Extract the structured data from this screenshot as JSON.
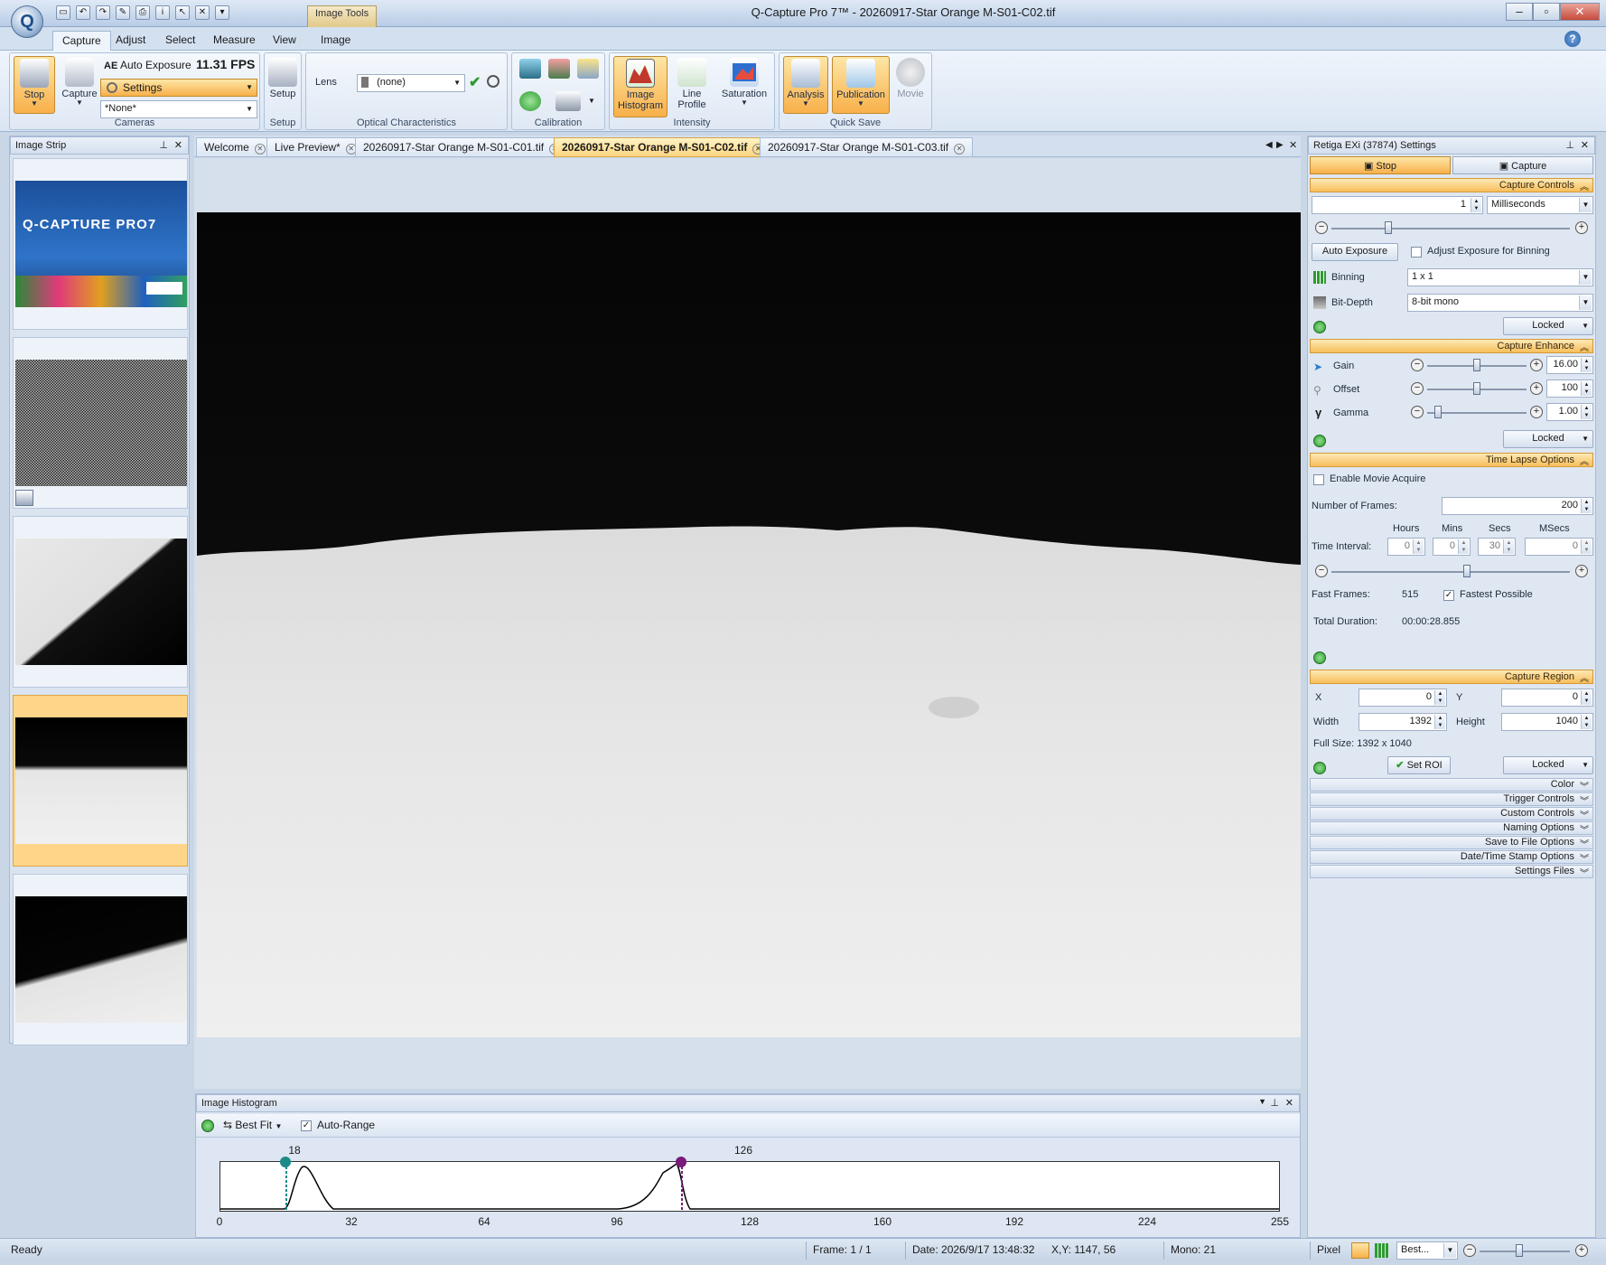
{
  "window": {
    "title": "Q-Capture Pro 7™ - 20260917-Star Orange M-S01-C02.tif",
    "app_logo": "Q",
    "contextual_tab": "Image Tools"
  },
  "ribbon_tabs": [
    "Capture",
    "Adjust",
    "Select",
    "Measure",
    "View",
    "Image"
  ],
  "ribbon": {
    "cameras": {
      "label": "Cameras",
      "stop": "Stop",
      "capture": "Capture",
      "auto_exposure": "Auto Exposure",
      "fps": "11.31 FPS",
      "settings": "Settings",
      "preset": "*None*"
    },
    "setup": {
      "label": "Setup",
      "button": "Setup"
    },
    "optical": {
      "label": "Optical Characteristics",
      "lens_label": "Lens",
      "lens_value": "(none)"
    },
    "calibration": {
      "label": "Calibration"
    },
    "intensity": {
      "label": "Intensity",
      "image_histogram_1": "Image",
      "image_histogram_2": "Histogram",
      "line_profile_1": "Line",
      "line_profile_2": "Profile",
      "saturation": "Saturation"
    },
    "quick_save": {
      "label": "Quick Save",
      "analysis": "Analysis",
      "publication": "Publication",
      "movie": "Movie"
    }
  },
  "image_strip": {
    "title": "Image Strip",
    "splash_brand": "Q-CAPTURE PRO7"
  },
  "doc_tabs": [
    "Welcome",
    "Live Preview*",
    "20260917-Star Orange M-S01-C01.tif",
    "20260917-Star Orange M-S01-C02.tif",
    "20260917-Star Orange M-S01-C03.tif"
  ],
  "histogram": {
    "title": "Image Histogram",
    "best_fit": "Best Fit",
    "auto_range": "Auto-Range",
    "low_marker": "18",
    "high_marker": "126",
    "ticks": [
      "0",
      "32",
      "64",
      "96",
      "128",
      "160",
      "192",
      "224",
      "255"
    ]
  },
  "settings": {
    "title": "Retiga EXi (37874) Settings",
    "stop": "Stop",
    "capture": "Capture",
    "capture_controls": {
      "header": "Capture Controls",
      "exposure_value": "1",
      "exposure_unit": "Milliseconds",
      "auto_exposure": "Auto Exposure",
      "adjust_binning": "Adjust Exposure for Binning",
      "binning_label": "Binning",
      "binning_value": "1 x 1",
      "bitdepth_label": "Bit-Depth",
      "bitdepth_value": "8-bit mono",
      "locked": "Locked"
    },
    "capture_enhance": {
      "header": "Capture Enhance",
      "gain_label": "Gain",
      "gain_value": "16.00",
      "offset_label": "Offset",
      "offset_value": "100",
      "gamma_label": "Gamma",
      "gamma_value": "1.00",
      "locked": "Locked"
    },
    "time_lapse": {
      "header": "Time Lapse Options",
      "enable_movie": "Enable Movie Acquire",
      "frames_label": "Number of  Frames:",
      "frames_value": "200",
      "col_hours": "Hours",
      "col_mins": "Mins",
      "col_secs": "Secs",
      "col_msecs": "MSecs",
      "interval_label": "Time Interval:",
      "hours": "0",
      "mins": "0",
      "secs": "30",
      "msecs": "0",
      "fast_frames_label": "Fast Frames:",
      "fast_frames_value": "515",
      "fastest_possible": "Fastest Possible",
      "total_duration_label": "Total Duration:",
      "total_duration_value": "00:00:28.855"
    },
    "capture_region": {
      "header": "Capture Region",
      "x_label": "X",
      "x_value": "0",
      "y_label": "Y",
      "y_value": "0",
      "width_label": "Width",
      "width_value": "1392",
      "height_label": "Height",
      "height_value": "1040",
      "full_size": "Full Size: 1392 x 1040",
      "set_roi": "Set ROI",
      "locked": "Locked"
    },
    "collapsed": [
      "Color",
      "Trigger Controls",
      "Custom Controls",
      "Naming Options",
      "Save to File Options",
      "Date/Time Stamp Options",
      "Settings Files"
    ]
  },
  "status": {
    "ready": "Ready",
    "frame": "Frame: 1 / 1",
    "date": "Date: 2026/9/17 13:48:32",
    "xy": "X,Y: 1147,   56",
    "mono": "Mono:   21",
    "unit": "Pixel",
    "zoom": "Best..."
  },
  "colors": {
    "accent_orange": "#f7be5a",
    "ribbon_blue": "#dbe6f3",
    "histogram_low_marker": "#1c8a86",
    "histogram_high_marker": "#7a1a7a"
  }
}
